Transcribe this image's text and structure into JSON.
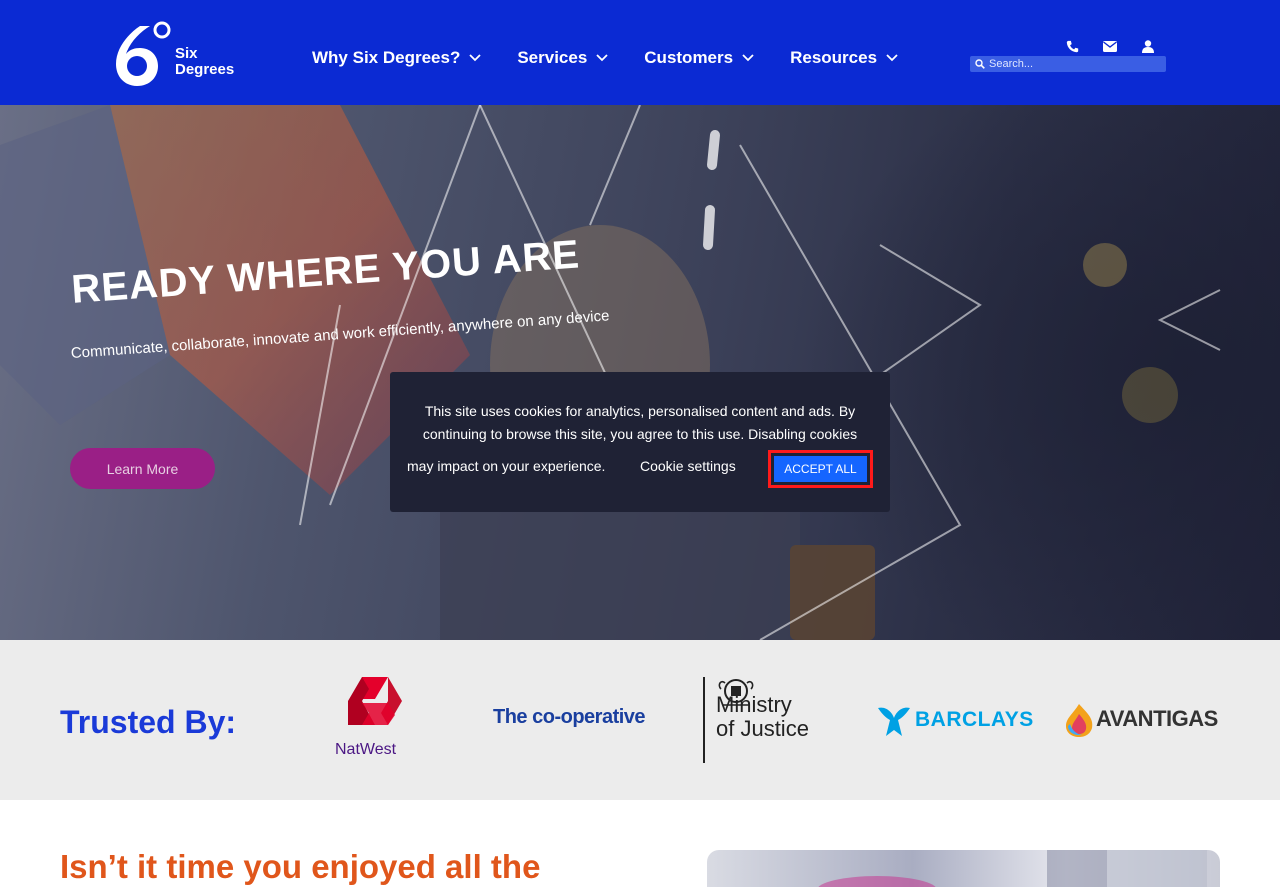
{
  "header": {
    "logo": {
      "number": "6",
      "line1": "Six",
      "line2": "Degrees"
    },
    "nav": [
      {
        "label": "Why Six Degrees?"
      },
      {
        "label": "Services"
      },
      {
        "label": "Customers"
      },
      {
        "label": "Resources"
      }
    ],
    "icons": [
      "phone-icon",
      "envelope-icon",
      "user-icon"
    ],
    "search": {
      "placeholder": "Search..."
    }
  },
  "hero": {
    "title": "READY WHERE YOU ARE",
    "subtitle": "Communicate, collaborate, innovate and work efficiently, anywhere on any device",
    "button_label": "Learn More"
  },
  "cookie": {
    "text": "This site uses cookies for analytics, personalised content and ads. By continuing to browse this site, you agree to this use. Disabling cookies",
    "text_line3": "may impact on your experience.",
    "settings_label": "Cookie settings",
    "accept_label": "ACCEPT ALL"
  },
  "trusted": {
    "title": "Trusted By:",
    "logos": {
      "natwest": "NatWest",
      "coop": "The co-operative",
      "moj_line1": "Ministry",
      "moj_line2": "of Justice",
      "barclays": "BARCLAYS",
      "avanti": "AVANTIGAS"
    }
  },
  "bottom": {
    "heading": "Isn’t it time you enjoyed all the"
  },
  "colors": {
    "header_bg": "#0b2ad3",
    "accent_magenta": "#9a1f86",
    "accept_blue": "#1565ff",
    "heading_orange": "#e0561b",
    "trusted_blue": "#1a3ad8"
  }
}
